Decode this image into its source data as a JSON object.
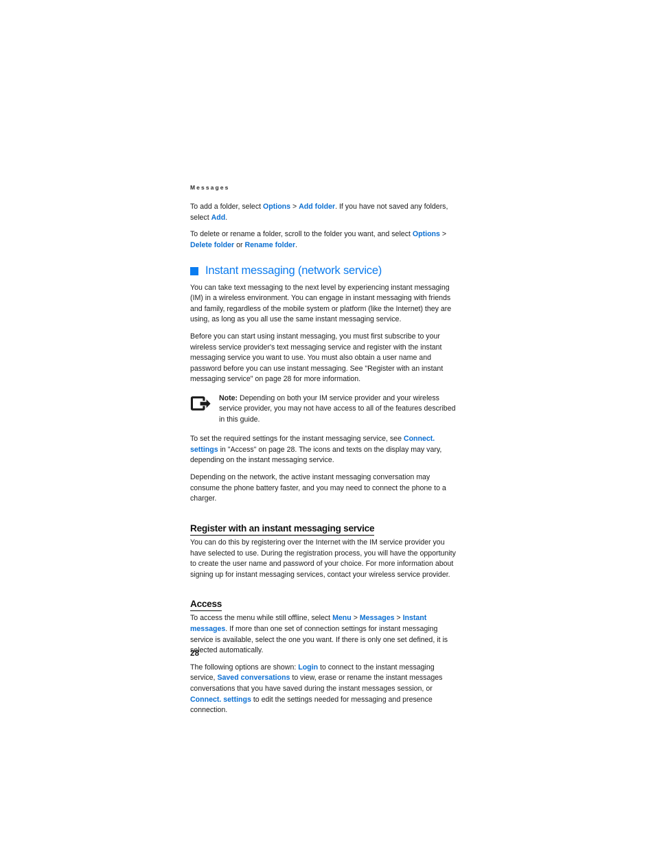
{
  "document": {
    "running_head": "Messages",
    "page_number": "28",
    "colors": {
      "link_blue": "#0c6fd1",
      "heading_blue": "#0b7bee",
      "bullet_blue": "#0a7cf0",
      "body_text": "#1b1b1b"
    }
  },
  "paragraphs": {
    "add_folder": {
      "part1": "To add a folder, select ",
      "link1": "Options",
      "sep1": " > ",
      "link2": "Add folder",
      "part2": ". If you have not saved any folders, select ",
      "link3": "Add",
      "part3": "."
    },
    "delete_rename": {
      "part1": "To delete or rename a folder, scroll to the folder you want, and select ",
      "link1": "Options",
      "sep1": " > ",
      "link2": "Delete folder",
      "part2": " or ",
      "link3": "Rename folder",
      "part3": "."
    },
    "im_intro": "You can take text messaging to the next level by experiencing instant messaging (IM) in a wireless environment. You can engage in instant messaging with friends and family, regardless of the mobile system or platform (like the Internet) they are using, as long as you all use the same instant messaging service.",
    "im_before": "Before you can start using instant messaging, you must first subscribe to your wireless service provider's text messaging service and register with the instant messaging service you want to use. You must also obtain a user name and password before you can use instant messaging. See \"Register with an instant messaging service\" on page 28 for more information.",
    "required_settings": {
      "part1": "To set the required settings for the instant messaging service, see ",
      "link1": "Connect. settings",
      "part2": " in \"Access\" on page 28. The icons and texts on the display may vary, depending on the instant messaging service."
    },
    "battery": "Depending on the network, the active instant messaging conversation may consume the phone battery faster, and you may need to connect the phone to a charger.",
    "register_body": "You can do this by registering over the Internet with the IM service provider you have selected to use. During the registration process, you will have the opportunity to create the user name and password of your choice. For more information about signing up for instant messaging services, contact your wireless service provider.",
    "access_menu": {
      "part1": "To access the menu while still offline, select ",
      "link1": "Menu",
      "sep1": " > ",
      "link2": "Messages",
      "sep2": " > ",
      "link3": "Instant messages",
      "part2": ". If more than one set of connection settings for instant messaging service is available, select the one you want. If there is only one set defined, it is selected automatically."
    },
    "access_options": {
      "part1": "The following options are shown: ",
      "link1": "Login",
      "part2": " to connect to the instant messaging service, ",
      "link2": "Saved conversations",
      "part3": " to view, erase or rename the instant messages conversations that you have saved during the instant messages session, or ",
      "link3": "Connect. settings",
      "part4": " to edit the settings needed for messaging and presence connection."
    }
  },
  "headings": {
    "chapter": "Instant messaging (network service)",
    "register": "Register with an instant messaging service",
    "access": "Access"
  },
  "note": {
    "label": "Note:",
    "text": " Depending on both your IM service provider and your wireless service provider, you may not have access to all of the features described in this guide.",
    "icon": "note-arrow-icon"
  }
}
